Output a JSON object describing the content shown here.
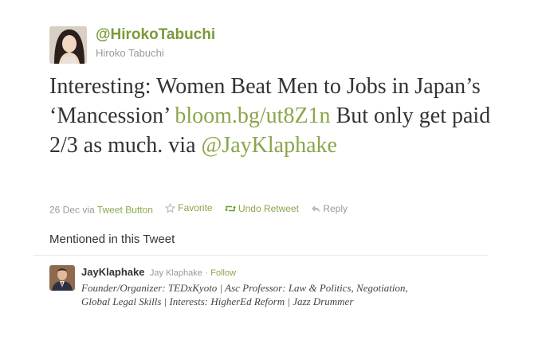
{
  "tweet": {
    "screen_name": "@HirokoTabuchi",
    "full_name": "Hiroko Tabuchi",
    "text_1": "Interesting: Women Beat Men to Jobs in Japan’s ‘Mancession’ ",
    "link": "bloom.bg/ut8Z1n",
    "text_2": " But only get paid 2/3 as much. via ",
    "mention": "@JayKlaphake"
  },
  "meta": {
    "date": "26 Dec",
    "via": "via",
    "source": "Tweet Button",
    "favorite": "Favorite",
    "undo_retweet": "Undo Retweet",
    "reply": "Reply"
  },
  "mentioned": {
    "heading": "Mentioned in this Tweet",
    "user": {
      "screen_name": "JayKlaphake",
      "full_name": "Jay Klaphake",
      "separator": "·",
      "follow": "Follow",
      "bio": "Founder/Organizer: TEDxKyoto | Asc Professor: Law & Politics, Negotiation, Global Legal Skills | Interests: HigherEd Reform | Jazz Drummer"
    }
  },
  "icons": {
    "favorite": "star-icon",
    "retweet": "retweet-icon",
    "reply": "reply-icon"
  },
  "colors": {
    "link": "#8aa64a",
    "text": "#333333",
    "muted": "#999999"
  }
}
